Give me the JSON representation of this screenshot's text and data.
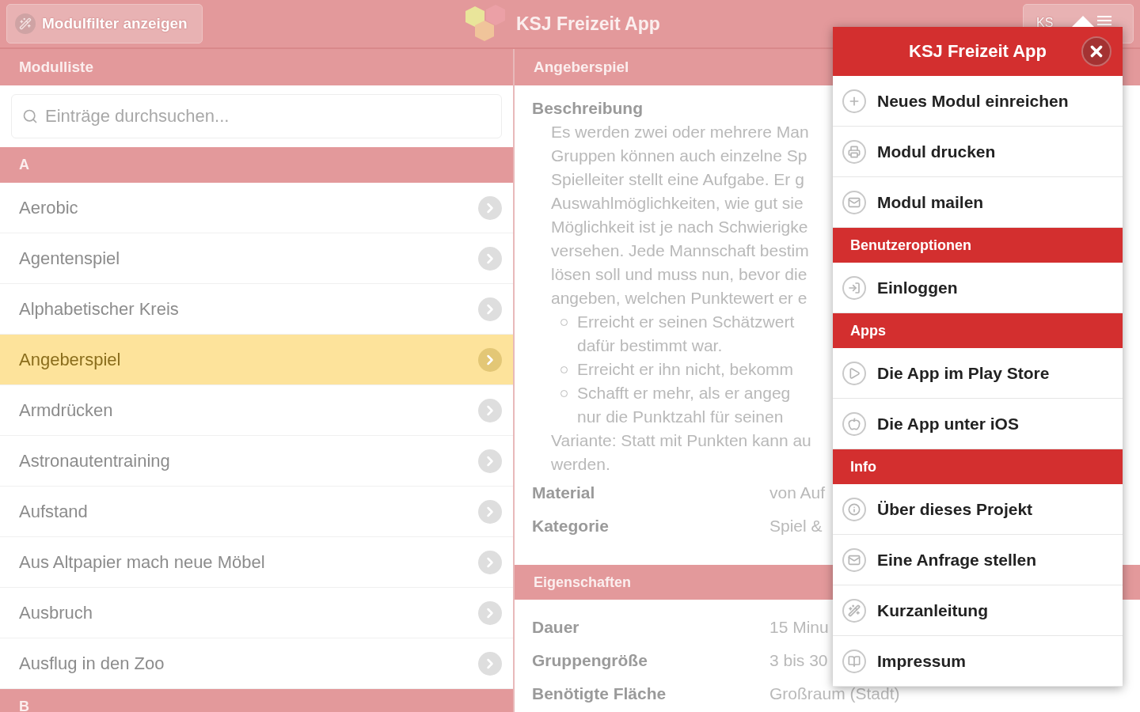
{
  "header": {
    "filter_button": "Modulfilter anzeigen",
    "title": "KSJ Freizeit App",
    "menu_button": "KS"
  },
  "module_list": {
    "title": "Modulliste",
    "search": {
      "placeholder": "Einträge durchsuchen..."
    },
    "groups": [
      {
        "letter": "A",
        "items": [
          {
            "label": "Aerobic",
            "selected": false
          },
          {
            "label": "Agentenspiel",
            "selected": false
          },
          {
            "label": "Alphabetischer Kreis",
            "selected": false
          },
          {
            "label": "Angeberspiel",
            "selected": true
          },
          {
            "label": "Armdrücken",
            "selected": false
          },
          {
            "label": "Astronautentraining",
            "selected": false
          },
          {
            "label": "Aufstand",
            "selected": false
          },
          {
            "label": "Aus Altpapier mach neue Möbel",
            "selected": false
          },
          {
            "label": "Ausbruch",
            "selected": false
          },
          {
            "label": "Ausflug in den Zoo",
            "selected": false
          }
        ]
      },
      {
        "letter": "B"
      }
    ]
  },
  "detail": {
    "title": "Angeberspiel",
    "description_label": "Beschreibung",
    "paragraph": [
      "Es werden zwei oder mehrere Man",
      "Gruppen können auch einzelne Sp",
      "Spielleiter stellt eine Aufgabe. Er g",
      "Auswahlmöglichkeiten, wie gut sie",
      "Möglichkeit ist je nach Schwierigke",
      "versehen. Jede Mannschaft bestim",
      "lösen soll und muss nun, bevor die",
      "angeben, welchen Punktewert er e"
    ],
    "bullets": [
      [
        "Erreicht er seinen Schätzwert",
        "dafür bestimmt war."
      ],
      [
        "Erreicht er ihn nicht, bekomm"
      ],
      [
        "Schafft er mehr, als er angeg",
        "nur die Punktzahl für seinen"
      ]
    ],
    "variant": [
      "Variante: Statt mit Punkten kann au",
      "werden."
    ],
    "facts": [
      {
        "label": "Material",
        "value": "von Auf"
      },
      {
        "label": "Kategorie",
        "value": "Spiel &"
      }
    ],
    "properties_title": "Eigenschaften",
    "properties": [
      {
        "label": "Dauer",
        "value": "15 Minu"
      },
      {
        "label": "Gruppengröße",
        "value": "3 bis 30"
      },
      {
        "label": "Benötigte Fläche",
        "value": "Großraum (Stadt)"
      }
    ]
  },
  "popup": {
    "title": "KSJ Freizeit App",
    "items": [
      {
        "kind": "item",
        "label": "Neues Modul einreichen"
      },
      {
        "kind": "item",
        "label": "Modul drucken"
      },
      {
        "kind": "item",
        "label": "Modul mailen"
      },
      {
        "kind": "section",
        "label": "Benutzeroptionen"
      },
      {
        "kind": "item",
        "label": "Einloggen"
      },
      {
        "kind": "section",
        "label": "Apps"
      },
      {
        "kind": "item",
        "label": "Die App im Play Store"
      },
      {
        "kind": "item",
        "label": "Die App unter iOS"
      },
      {
        "kind": "section",
        "label": "Info"
      },
      {
        "kind": "item",
        "label": "Über dieses Projekt"
      },
      {
        "kind": "item",
        "label": "Eine Anfrage stellen"
      },
      {
        "kind": "item",
        "label": "Kurzanleitung"
      },
      {
        "kind": "item",
        "label": "Impressum"
      }
    ]
  }
}
